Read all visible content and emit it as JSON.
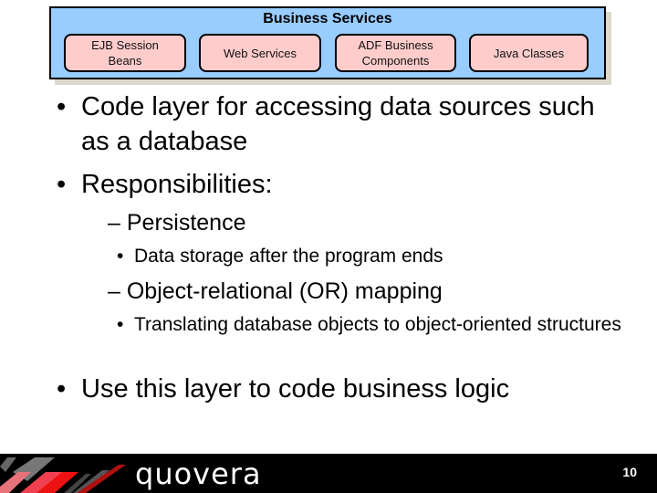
{
  "diagram": {
    "title": "Business Services",
    "components": [
      {
        "label_line1": "EJB Session",
        "label_line2": "Beans"
      },
      {
        "label_line1": "Web Services",
        "label_line2": ""
      },
      {
        "label_line1": "ADF Business",
        "label_line2": "Components"
      },
      {
        "label_line1": "Java Classes",
        "label_line2": ""
      }
    ],
    "colors": {
      "container": "#99ccff",
      "component": "#ffcccc",
      "border": "#000000"
    }
  },
  "bullets": {
    "b1": "Code layer for accessing data sources such as a database",
    "b2": "Responsibilities:",
    "b2_sub1": "Persistence",
    "b2_sub1_detail": "Data storage after the program ends",
    "b2_sub2": "Object-relational (OR) mapping",
    "b2_sub2_detail": "Translating database objects to object-oriented structures",
    "b3": "Use this layer to code business logic",
    "bullet_glyph": "•",
    "dash_glyph": "–"
  },
  "footer": {
    "brand": "quovera",
    "page_number": "10"
  }
}
